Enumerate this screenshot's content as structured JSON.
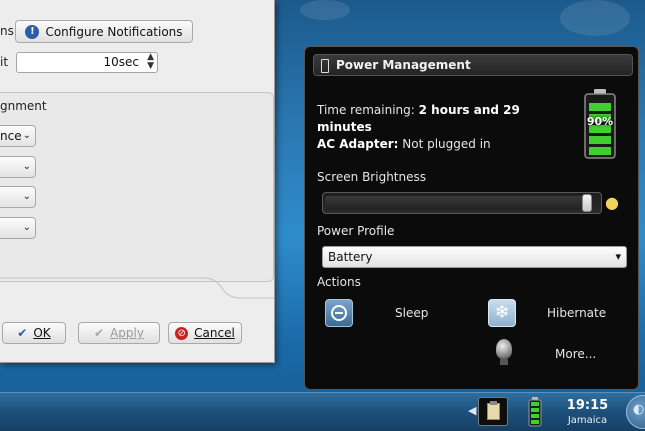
{
  "dialog": {
    "notifications_label_fragment": "ns",
    "configure_notifications_button": "Configure Notifications",
    "limit_label_fragment": "it",
    "spin_value": "10sec",
    "group_title_fragment": "gnment",
    "dropdown_1_fragment": "nce",
    "ok_button": "OK",
    "apply_button": "Apply",
    "cancel_button": "Cancel"
  },
  "power_management": {
    "title": "Power Management",
    "time_remaining_label": "Time remaining:",
    "time_remaining_value": "2 hours and 29",
    "time_remaining_value_cont": "minutes",
    "ac_adapter_label": "AC Adapter:",
    "ac_adapter_value": "Not plugged in",
    "battery_percent": "90%",
    "battery_level": 0.9,
    "screen_brightness_label": "Screen Brightness",
    "brightness_level": 0.98,
    "power_profile_label": "Power Profile",
    "power_profile_value": "Battery",
    "actions_label": "Actions",
    "sleep_label": "Sleep",
    "hibernate_label": "Hibernate",
    "more_label": "More..."
  },
  "taskbar": {
    "time": "19:15",
    "timezone": "Jamaica"
  },
  "colors": {
    "desktop_blue": "#2a78b3",
    "battery_green": "#3fcf2f",
    "popup_bg": "#0b0b0b"
  }
}
